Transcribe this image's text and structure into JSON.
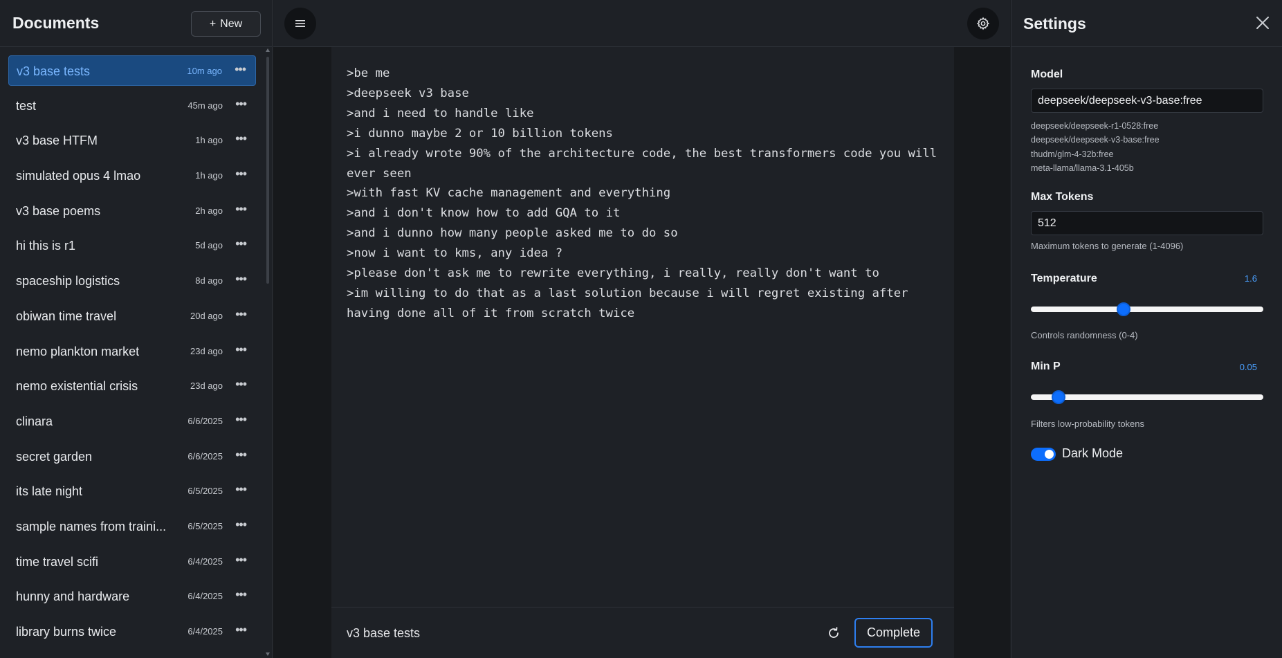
{
  "sidebar": {
    "title": "Documents",
    "new_label": "New",
    "documents": [
      {
        "name": "v3 base tests",
        "time": "10m ago",
        "active": true
      },
      {
        "name": "test",
        "time": "45m ago"
      },
      {
        "name": "v3 base HTFM",
        "time": "1h ago"
      },
      {
        "name": "simulated opus 4 lmao",
        "time": "1h ago"
      },
      {
        "name": "v3 base poems",
        "time": "2h ago"
      },
      {
        "name": "hi this is r1",
        "time": "5d ago"
      },
      {
        "name": "spaceship logistics",
        "time": "8d ago"
      },
      {
        "name": "obiwan time travel",
        "time": "20d ago"
      },
      {
        "name": "nemo plankton market",
        "time": "23d ago"
      },
      {
        "name": "nemo existential crisis",
        "time": "23d ago"
      },
      {
        "name": "clinara",
        "time": "6/6/2025"
      },
      {
        "name": "secret garden",
        "time": "6/6/2025"
      },
      {
        "name": "its late night",
        "time": "6/5/2025"
      },
      {
        "name": "sample names from traini...",
        "time": "6/5/2025"
      },
      {
        "name": "time travel scifi",
        "time": "6/4/2025"
      },
      {
        "name": "hunny and hardware",
        "time": "6/4/2025"
      },
      {
        "name": "library burns twice",
        "time": "6/4/2025"
      }
    ]
  },
  "editor": {
    "text": ">be me\n>deepseek v3 base\n>and i need to handle like\n>i dunno maybe 2 or 10 billion tokens\n>i already wrote 90% of the architecture code, the best transformers code you will ever seen\n>with fast KV cache management and everything\n>and i don't know how to add GQA to it\n>and i dunno how many people asked me to do so\n>now i want to kms, any idea ?\n>please don't ask me to rewrite everything, i really, really don't want to\n>im willing to do that as a last solution because i will regret existing after having done all of it from scratch twice",
    "doc_title": "v3 base tests",
    "complete_label": "Complete"
  },
  "settings": {
    "title": "Settings",
    "model_label": "Model",
    "model_value": "deepseek/deepseek-v3-base:free",
    "model_options": [
      "deepseek/deepseek-r1-0528:free",
      "deepseek/deepseek-v3-base:free",
      "thudm/glm-4-32b:free",
      "meta-llama/llama-3.1-405b"
    ],
    "max_tokens_label": "Max Tokens",
    "max_tokens_value": "512",
    "max_tokens_help": "Maximum tokens to generate (1-4096)",
    "temperature_label": "Temperature",
    "temperature_value": "1.6",
    "temperature_help": "Controls randomness (0-4)",
    "temperature_fraction": 0.4,
    "min_p_label": "Min P",
    "min_p_value": "0.05",
    "min_p_help": "Filters low-probability tokens",
    "min_p_fraction": 0.12,
    "dark_mode_label": "Dark Mode",
    "dark_mode_on": true
  },
  "icons": {
    "menu": "hamburger-menu-icon",
    "gear": "gear-icon",
    "close": "close-icon",
    "refresh": "refresh-icon",
    "more": "more-horizontal-icon",
    "plus": "plus-icon"
  },
  "colors": {
    "accent": "#0d6efd",
    "active_item": "#1a4a80",
    "active_text": "#7ab7ff",
    "value_text": "#4aa0ff"
  }
}
